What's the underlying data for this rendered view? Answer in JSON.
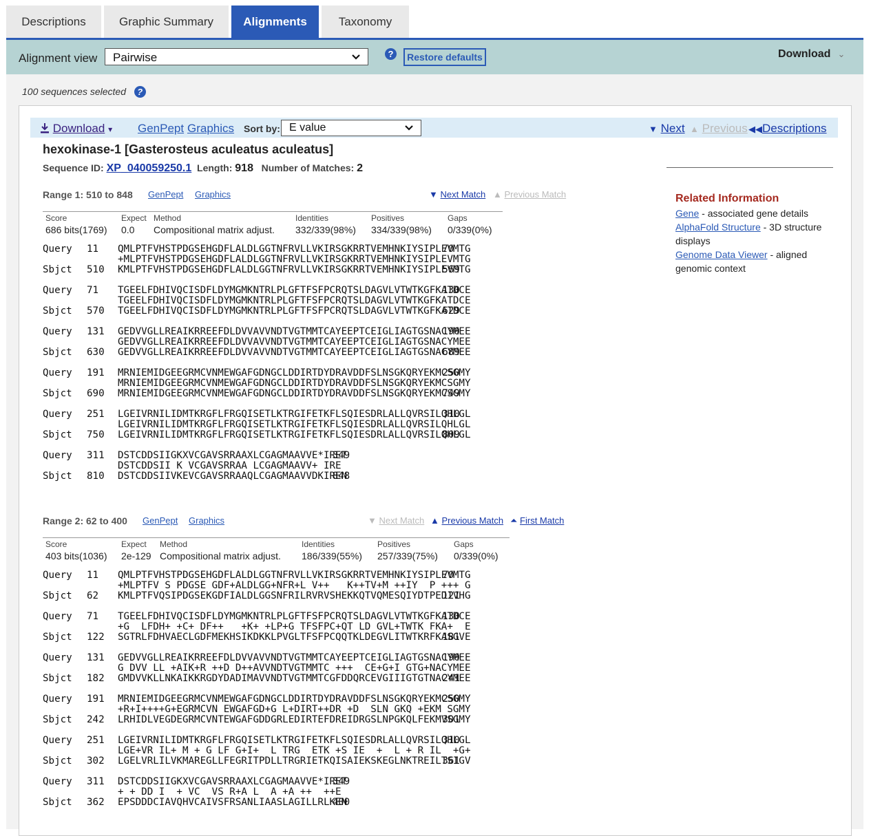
{
  "tabs": [
    {
      "label": "Descriptions"
    },
    {
      "label": "Graphic Summary"
    },
    {
      "label": "Alignments"
    },
    {
      "label": "Taxonomy"
    }
  ],
  "toolbar": {
    "alignment_view_label": "Alignment view",
    "alignment_view_value": "Pairwise",
    "restore_label": "Restore defaults",
    "download_label": "Download"
  },
  "selected_text": "100 sequences selected",
  "subbar": {
    "download_label": "Download",
    "genpept_label": "GenPept",
    "graphics_label": "Graphics",
    "sort_by_label": "Sort by:",
    "sort_value": "E value",
    "next_label": "Next",
    "previous_label": "Previous",
    "descriptions_label": "Descriptions"
  },
  "hit": {
    "title": "hexokinase-1 [Gasterosteus aculeatus aculeatus]",
    "seq_id_label": "Sequence ID:",
    "seq_id": "XP_040059250.1",
    "length_label": "Length:",
    "length": "918",
    "matches_label": "Number of Matches:",
    "matches": "2"
  },
  "related": {
    "title": "Related Information",
    "items": [
      {
        "link": "Gene",
        "desc": "- associated gene details"
      },
      {
        "link": "AlphaFold Structure",
        "desc": "- 3D structure displays"
      },
      {
        "link": "Genome Data Viewer",
        "desc": "- aligned genomic context"
      }
    ]
  },
  "stat_headers": [
    "Score",
    "Expect",
    "Method",
    "Identities",
    "Positives",
    "Gaps"
  ],
  "ranges": [
    {
      "title": "Range 1: 510 to 848",
      "genpept": "GenPept",
      "graphics": "Graphics",
      "next_match": "Next Match",
      "previous_match": "Previous Match",
      "first_match": "",
      "stats": [
        "686 bits(1769)",
        "0.0",
        "Compositional matrix adjust.",
        "332/339(98%)",
        "334/339(98%)",
        "0/339(0%)"
      ],
      "blocks": [
        {
          "qs": "11",
          "q": "QMLPTFVHSTPDGSEHGDFLALDLGGTNFRVLLVKIRSGKRRTVEMHNKIYSIPLEVMTG",
          "qe": "70",
          "m": "+MLPTFVHSTPDGSEHGDFLALDLGGTNFRVLLVKIRSGKRRTVEMHNKIYSIPLEVMTG",
          "ss": "510",
          "s": "KMLPTFVHSTPDGSEHGDFLALDLGGTNFRVLLVKIRSGKRRTVEMHNKIYSIPLEVMTG",
          "se": "569"
        },
        {
          "qs": "71",
          "q": "TGEELFDHIVQCISDFLDYMGMKNTRLPLGFTFSFPCRQTSLDAGVLVTWTKGFKATDCE",
          "qe": "130",
          "m": "TGEELFDHIVQCISDFLDYMGMKNTRLPLGFTFSFPCRQTSLDAGVLVTWTKGFKATDCE",
          "ss": "570",
          "s": "TGEELFDHIVQCISDFLDYMGMKNTRLPLGFTFSFPCRQTSLDAGVLVTWTKGFKATDCE",
          "se": "629"
        },
        {
          "qs": "131",
          "q": "GEDVVGLLREAIKRREEFDLDVVAVVNDTVGTMMTCAYEEPTCEIGLIAGTGSNACYMEE",
          "qe": "190",
          "m": "GEDVVGLLREAIKRREEFDLDVVAVVNDTVGTMMTCAYEEPTCEIGLIAGTGSNACYMEE",
          "ss": "630",
          "s": "GEDVVGLLREAIKRREEFDLDVVAVVNDTVGTMMTCAYEEPTCEIGLIAGTGSNACYMEE",
          "se": "689"
        },
        {
          "qs": "191",
          "q": "MRNIEMIDGEEGRMCVNMEWGAFGDNGCLDDIRTDYDRAVDDFSLNSGKQRYEKMCSGMY",
          "qe": "250",
          "m": "MRNIEMIDGEEGRMCVNMEWGAFGDNGCLDDIRTDYDRAVDDFSLNSGKQRYEKMCSGMY",
          "ss": "690",
          "s": "MRNIEMIDGEEGRMCVNMEWGAFGDNGCLDDIRTDYDRAVDDFSLNSGKQRYEKMCSGMY",
          "se": "749"
        },
        {
          "qs": "251",
          "q": "LGEIVRNILIDMTKRGFLFRGQISETLKTRGIFETKFLSQIESDRLALLQVRSILQHLGL",
          "qe": "310",
          "m": "LGEIVRNILIDMTKRGFLFRGQISETLKTRGIFETKFLSQIESDRLALLQVRSILQHLGL",
          "ss": "750",
          "s": "LGEIVRNILIDMTKRGFLFRGQISETLKTRGIFETKFLSQIESDRLALLQVRSILQHLGL",
          "se": "809"
        },
        {
          "qs": "311",
          "q": "DSTCDDSIIGKXVCGAVSRRAAXLCGAGMAAVVE*IRET",
          "qe": "349",
          "m": "DSTCDDSII K VCGAVSRRAA LCGAGMAAVV+ IRE",
          "ss": "810",
          "s": "DSTCDDSIIVKEVCGAVSRRAAQLCGAGMAAVVDKIREN",
          "se": "848"
        }
      ]
    },
    {
      "title": "Range 2: 62 to 400",
      "genpept": "GenPept",
      "graphics": "Graphics",
      "next_match": "Next Match",
      "previous_match": "Previous Match",
      "first_match": "First Match",
      "stats": [
        "403 bits(1036)",
        "2e-129",
        "Compositional matrix adjust.",
        "186/339(55%)",
        "257/339(75%)",
        "0/339(0%)"
      ],
      "blocks": [
        {
          "qs": "11",
          "q": "QMLPTFVHSTPDGSEHGDFLALDLGGTNFRVLLVKIRSGKRRTVEMHNKIYSIPLEVMTG",
          "qe": "70",
          "m": "+MLPTFV S PDGSE GDF+ALDLGG+NFR+L V++   K++TV+M ++IY  P +++ G",
          "ss": "62",
          "s": "KMLPTFVQSIPDGSEKGDFIALDLGGSNFRILRVRVSHEKKQTVQMESQIYDTPEDIVHG",
          "se": "121"
        },
        {
          "qs": "71",
          "q": "TGEELFDHIVQCISDFLDYMGMKNTRLPLGFTFSFPCRQTSLDAGVLVTWTKGFKATDCE",
          "qe": "130",
          "m": "+G  LFDH+ +C+ DF++   +K+ +LP+G TFSFPC+QT LD GVL+TWTK FKA+  E",
          "ss": "122",
          "s": "SGTRLFDHVAECLGDFMEKHSIKDKKLPVGLTFSFPCQQTKLDEGVLITWTKRFKASGVE",
          "se": "181"
        },
        {
          "qs": "131",
          "q": "GEDVVGLLREAIKRREEFDLDVVAVVNDTVGTMMTCAYEEPTCEIGLIAGTGSNACYMEE",
          "qe": "190",
          "m": "G DVV LL +AIK+R ++D D++AVVNDTVGTMMTC +++  CE+G+I GTG+NACYMEE",
          "ss": "182",
          "s": "GMDVVKLLNKAIKKRGDYDADIMAVVNDTVGTMMTCGFDDQRCEVGIIIGTGTNACYMEE",
          "se": "241"
        },
        {
          "qs": "191",
          "q": "MRNIEMIDGEEGRMCVNMEWGAFGDNGCLDDIRTDYDRAVDDFSLNSGKQRYEKMCSGMY",
          "qe": "250",
          "m": "+R+I++++G+EGRMCVN EWGAFGD+G L+DIRT++DR +D  SLN GKQ +EKM SGMY",
          "ss": "242",
          "s": "LRHIDLVEGDEGRMCVNTEWGAFGDDGRLEDIRTEFDREIDRGSLNPGKQLFEKMVSGMY",
          "se": "301"
        },
        {
          "qs": "251",
          "q": "LGEIVRNILIDMTKRGFLFRGQISETLKTRGIFETKFLSQIESDRLALLQVRSILQHLGL",
          "qe": "310",
          "m": "LGE+VR IL+ M + G LF G+I+  L TRG  ETK +S IE  +  L + R IL  +G+",
          "ss": "302",
          "s": "LGELVRLILVKMAREGLLFEGRITPDLLTRGRIETKQISAIEKSKEGLNKTREILTSIGV",
          "se": "361"
        },
        {
          "qs": "311",
          "q": "DSTCDDSIIGKXVCGAVSRRAAXLCGAGMAAVVE*IRET",
          "qe": "349",
          "m": "+ + DD I  + VC  VS R+A L  A +A ++  ++E",
          "ss": "362",
          "s": "EPSDDDCIAVQHVCAIVSFRSANLIAASLAGILLRLKEN",
          "se": "400"
        }
      ]
    }
  ]
}
